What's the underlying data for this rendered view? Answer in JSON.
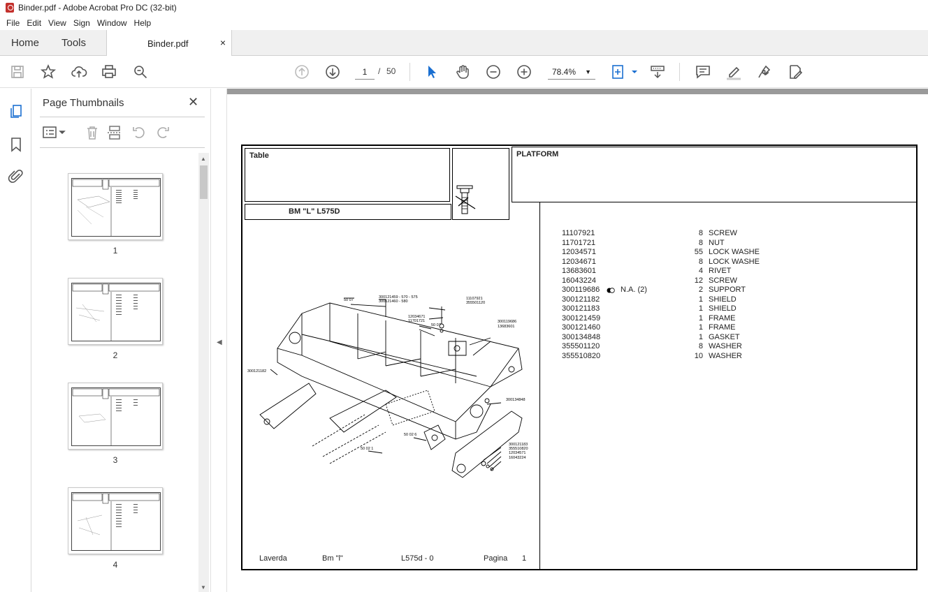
{
  "window": {
    "title": "Binder.pdf - Adobe Acrobat Pro DC (32-bit)"
  },
  "menu": [
    "File",
    "Edit",
    "View",
    "Sign",
    "Window",
    "Help"
  ],
  "tabs": {
    "home": "Home",
    "tools": "Tools",
    "document": "Binder.pdf",
    "close": "×"
  },
  "toolbar": {
    "current_page": "1",
    "page_separator": "/",
    "total_pages": "50",
    "zoom": "78.4%"
  },
  "thumbnails_panel": {
    "title": "Page Thumbnails",
    "close": "✕",
    "pages": [
      "1",
      "2",
      "3",
      "4"
    ]
  },
  "document": {
    "table_label": "Table",
    "platform_label": "PLATFORM",
    "model_label": "BM \"L\" L575D",
    "parts": [
      {
        "code": "11107921",
        "qty": "8",
        "desc": "SCREW"
      },
      {
        "code": "11701721",
        "qty": "8",
        "desc": "NUT"
      },
      {
        "code": "12034571",
        "qty": "55",
        "desc": "LOCK WASHE"
      },
      {
        "code": "12034671",
        "qty": "8",
        "desc": "LOCK WASHE"
      },
      {
        "code": "13683601",
        "qty": "4",
        "desc": "RIVET"
      },
      {
        "code": "16043224",
        "qty": "12",
        "desc": "SCREW"
      },
      {
        "code": "300119686",
        "qty": "2",
        "desc": "SUPPORT",
        "note": "N.A.  (2)"
      },
      {
        "code": "300121182",
        "qty": "1",
        "desc": "SHIELD"
      },
      {
        "code": "300121183",
        "qty": "1",
        "desc": "SHIELD"
      },
      {
        "code": "300121459",
        "qty": "1",
        "desc": "FRAME"
      },
      {
        "code": "300121460",
        "qty": "1",
        "desc": "FRAME"
      },
      {
        "code": "300134848",
        "qty": "1",
        "desc": "GASKET"
      },
      {
        "code": "355501120",
        "qty": "8",
        "desc": "WASHER"
      },
      {
        "code": "355510820",
        "qty": "10",
        "desc": "WASHER"
      }
    ],
    "footer": {
      "maker": "Laverda",
      "model": "Bm \"l\"",
      "code": "L575d - 0",
      "page_label": "Pagina",
      "page_number": "1"
    },
    "callouts": {
      "c1": "50 07",
      "c2": "300121459 - 570 - 575",
      "c3": "300121460 - 580",
      "c4": "11107921",
      "c5": "355501120",
      "c6": "12034671",
      "c7": "11701721",
      "c8": "50 07",
      "c9": "300119686",
      "c10": "13683601",
      "c11": "300121182",
      "c12": "300134848",
      "c13": "50 02 6",
      "c14": "50 02 1",
      "c15": "300121183",
      "c16": "355510820",
      "c17": "12034571",
      "c18": "16043224"
    }
  }
}
